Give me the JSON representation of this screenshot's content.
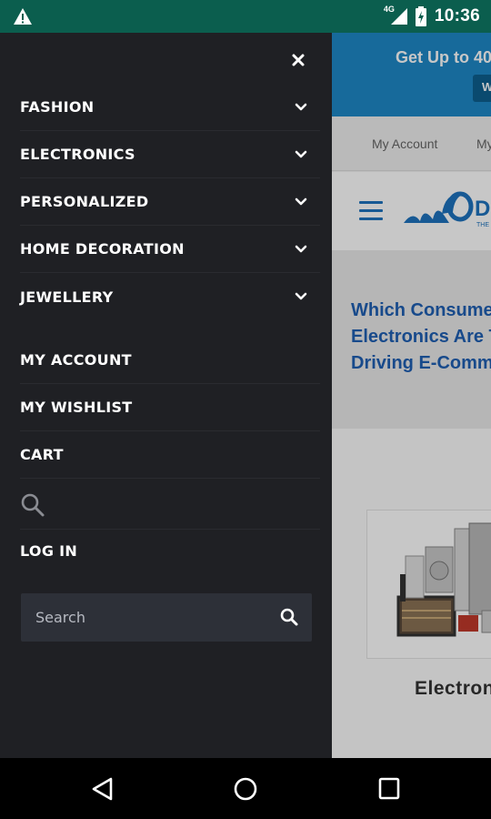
{
  "status_bar": {
    "time": "10:36",
    "network": "4G",
    "warning_icon": "warning-icon",
    "battery_icon": "battery-charging-icon",
    "signal_icon": "signal-icon",
    "bg_color": "#0b5e4e"
  },
  "drawer": {
    "close_icon": "close-icon",
    "categories": [
      {
        "label": "FASHION",
        "icon": "chevron-down-icon"
      },
      {
        "label": "ELECTRONICS",
        "icon": "chevron-down-icon"
      },
      {
        "label": "PERSONALIZED",
        "icon": "chevron-down-icon"
      },
      {
        "label": "HOME DECORATION",
        "icon": "chevron-down-icon"
      },
      {
        "label": "JEWELLERY",
        "icon": "chevron-down-icon"
      }
    ],
    "links": [
      {
        "label": "MY ACCOUNT"
      },
      {
        "label": "MY WISHLIST"
      },
      {
        "label": "CART"
      }
    ],
    "search_icon": "search-icon",
    "login_label": "LOG IN",
    "search": {
      "placeholder": "Search",
      "value": ""
    },
    "bg_color": "#1f2024"
  },
  "page": {
    "promo_text": "Get Up to 40",
    "promo_button": "W",
    "account_link": "My Account",
    "account_link_2": "My",
    "logo_text": "D",
    "logo_tagline": "THE",
    "headline": "Which Consume\nElectronics Are T\nDriving E-Comme",
    "product_title": "Electron",
    "accent_color": "#1e88c7"
  },
  "nav_bar": {
    "back_icon": "back-icon",
    "home_icon": "home-icon",
    "recents_icon": "recents-icon"
  }
}
